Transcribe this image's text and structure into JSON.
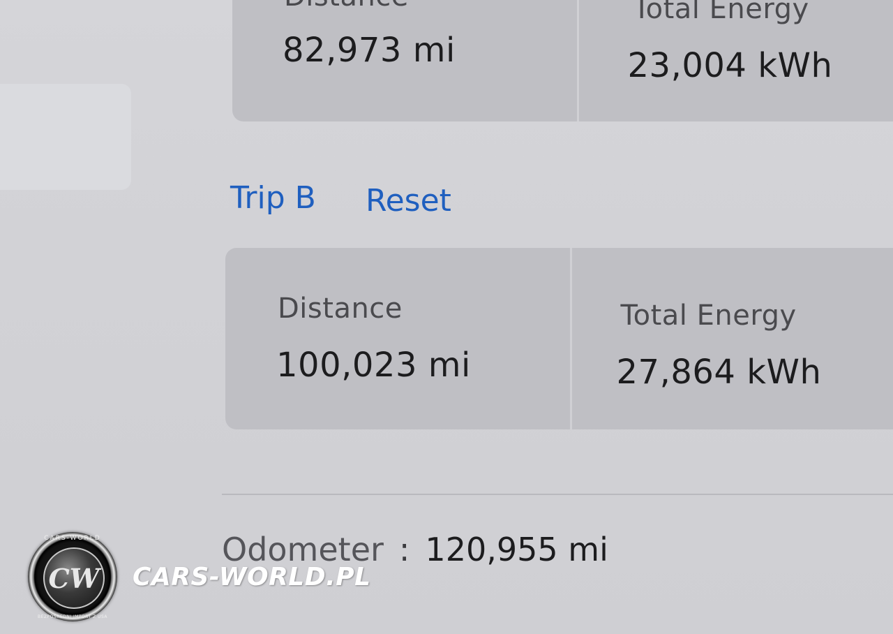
{
  "trip_a": {
    "distance_label": "Distance",
    "distance_value": "82,973",
    "distance_unit": "mi",
    "energy_label": "Total Energy",
    "energy_value": "23,004",
    "energy_unit": "kWh"
  },
  "trip_b": {
    "title": "Trip B",
    "reset_label": "Reset",
    "distance_label": "Distance",
    "distance_value": "100,023",
    "distance_unit": "mi",
    "energy_label": "Total Energy",
    "energy_value": "27,864",
    "energy_unit": "kWh"
  },
  "odometer": {
    "label": "Odometer",
    "separator": ":",
    "value": "120,955",
    "unit": "mi"
  },
  "watermark": {
    "logo_monogram": "CW",
    "logo_ring_top": "CARS-WORLD",
    "logo_ring_bottom": "BEZPOŚREDNI IMPORT Z USA",
    "brand_text": "CARS-WORLD.PL"
  },
  "colors": {
    "accent_link": "#1f5fbf",
    "card_background": "#bfbfc4",
    "page_background": "#d2d2d6"
  }
}
